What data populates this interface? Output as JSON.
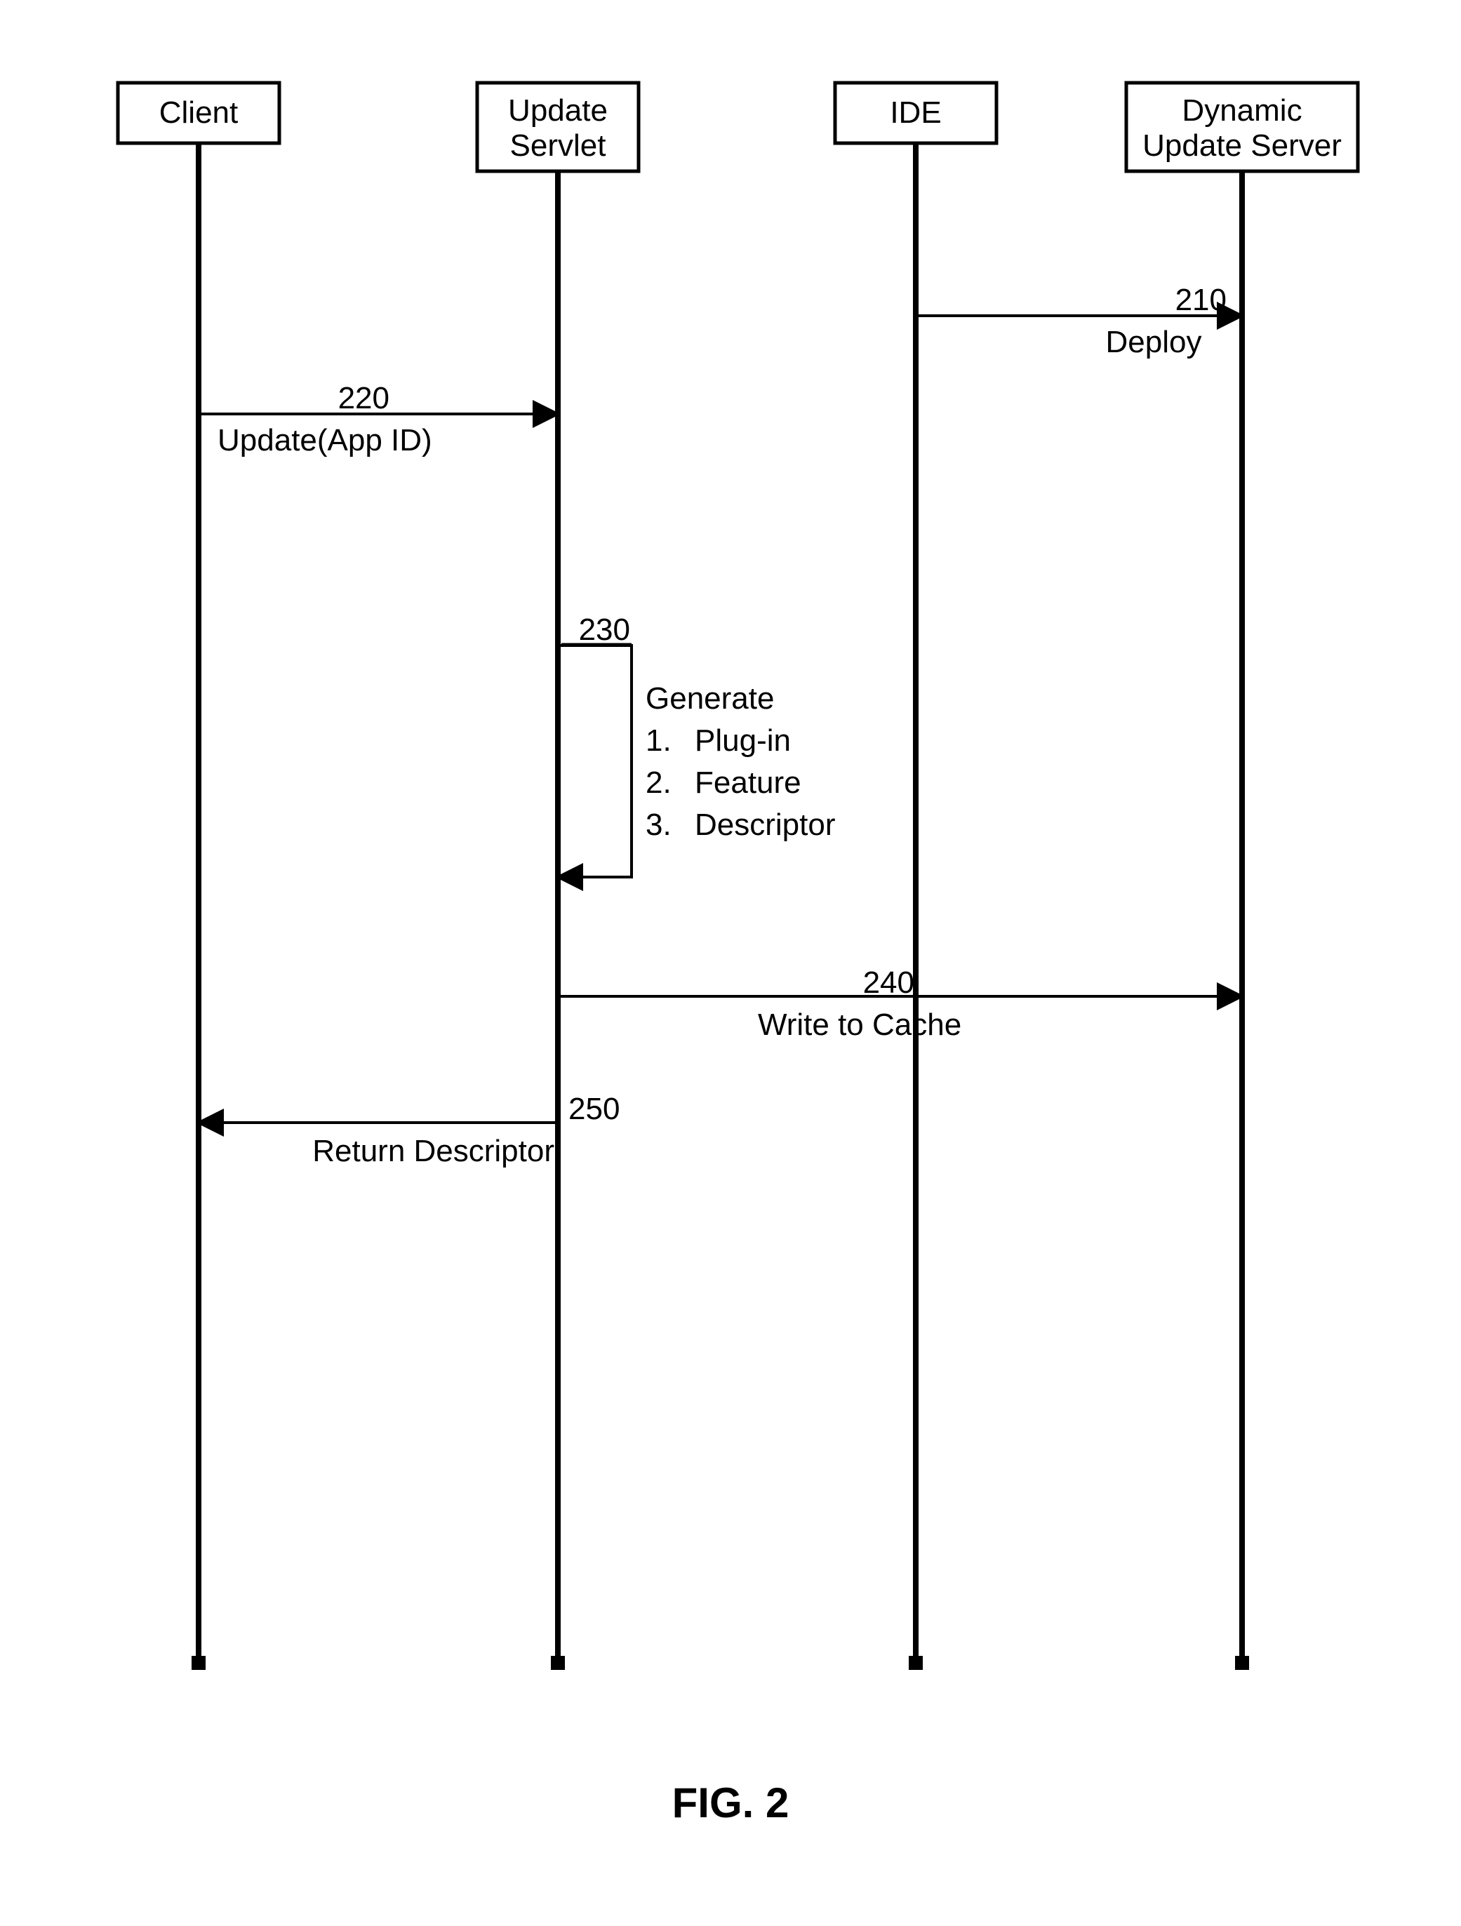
{
  "participants": {
    "client": "Client",
    "updateServlet_l1": "Update",
    "updateServlet_l2": "Servlet",
    "ide": "IDE",
    "dus_l1": "Dynamic",
    "dus_l2": "Update Server"
  },
  "messages": {
    "m210": {
      "num": "210",
      "label": "Deploy"
    },
    "m220": {
      "num": "220",
      "label": "Update(App ID)"
    },
    "m230": {
      "num": "230",
      "label": "Generate",
      "items": [
        "Plug-in",
        "Feature",
        "Descriptor"
      ]
    },
    "m240": {
      "num": "240",
      "label": "Write to Cache"
    },
    "m250": {
      "num": "250",
      "label": "Return Descriptor"
    }
  },
  "figure_title": "FIG. 2"
}
